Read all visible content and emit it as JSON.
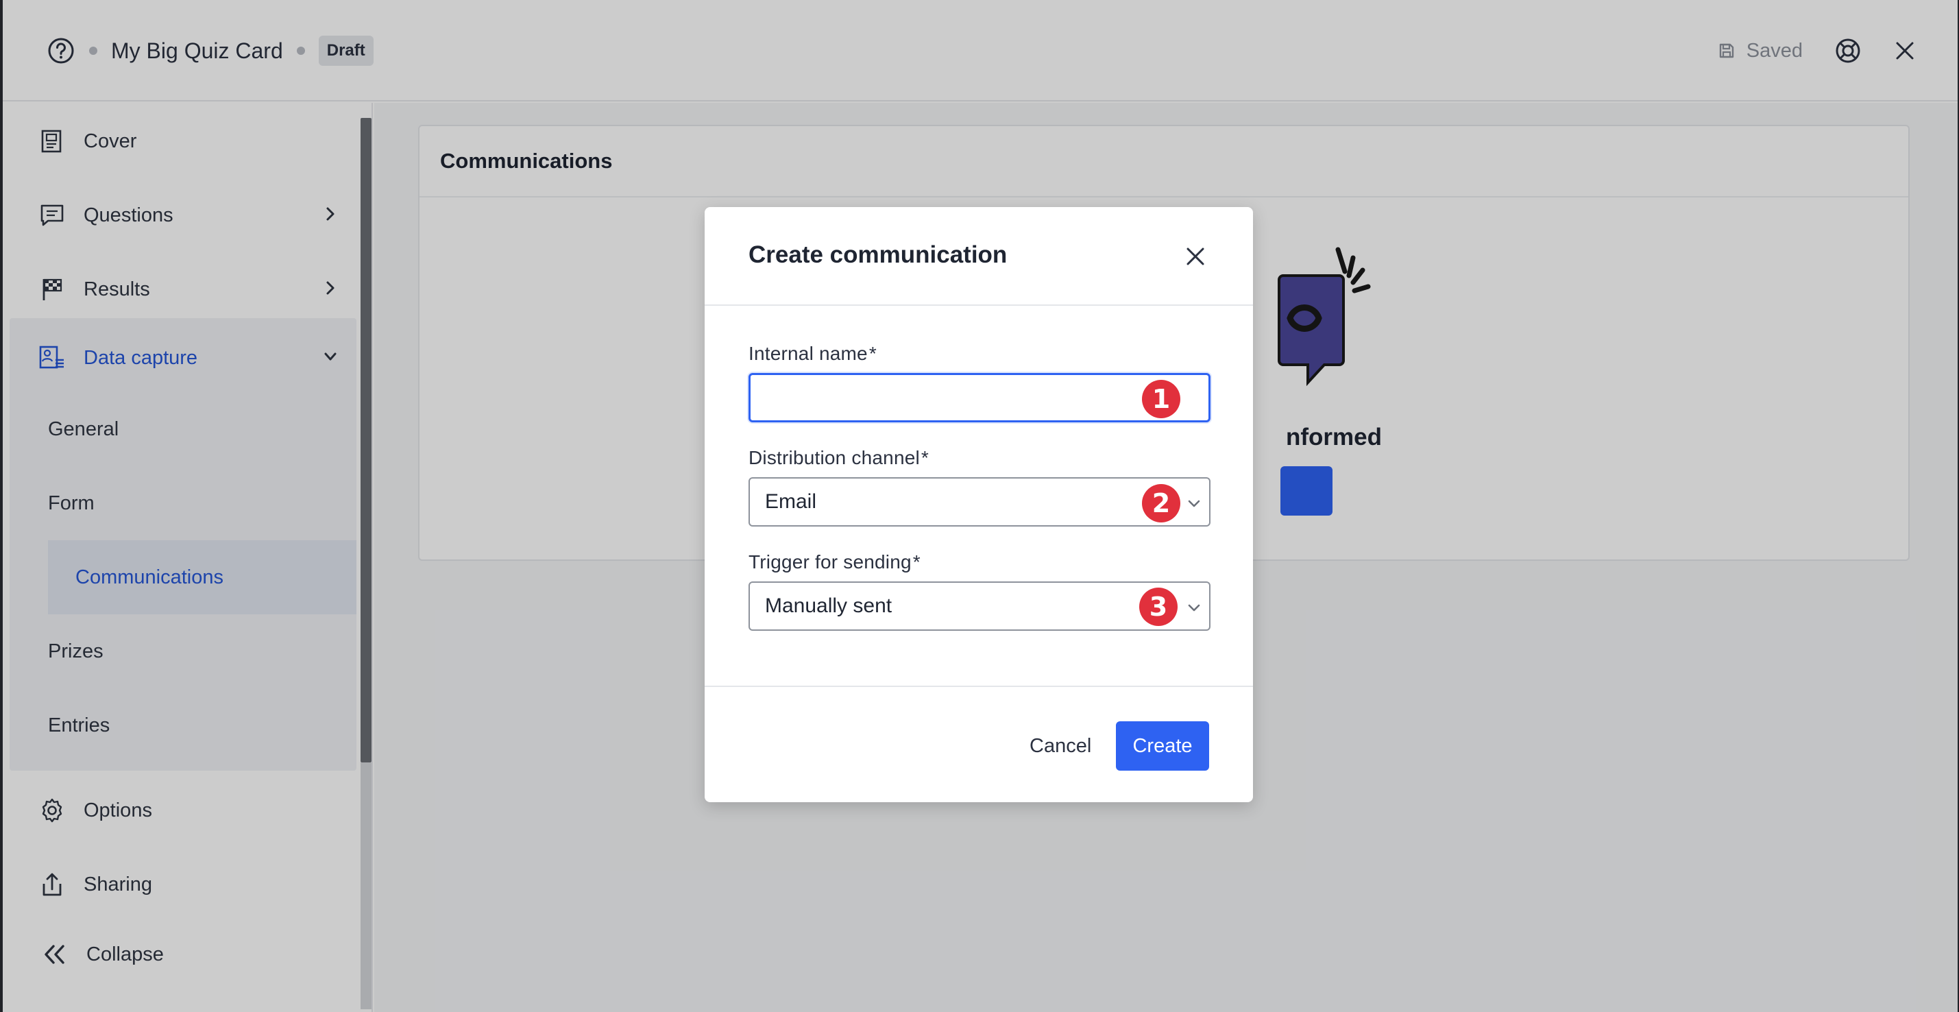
{
  "header": {
    "title": "My Big Quiz Card",
    "status_badge": "Draft",
    "saved_label": "Saved"
  },
  "sidebar": {
    "items": [
      {
        "label": "Cover",
        "icon": "cover-page-icon"
      },
      {
        "label": "Questions",
        "icon": "chat-bubble-icon"
      },
      {
        "label": "Results",
        "icon": "checkered-flag-icon"
      },
      {
        "label": "Data capture",
        "icon": "contact-form-icon"
      },
      {
        "label": "Options",
        "icon": "gear-icon"
      },
      {
        "label": "Sharing",
        "icon": "share-icon"
      },
      {
        "label": "Collapse",
        "icon": "double-chevron-left-icon"
      }
    ],
    "data_capture_subitems": [
      "General",
      "Form",
      "Communications",
      "Prizes",
      "Entries"
    ],
    "selected_subitem": "Communications"
  },
  "main": {
    "card_title": "Communications",
    "empty_state_text": "nformed"
  },
  "modal": {
    "title": "Create communication",
    "fields": [
      {
        "label": "Internal name",
        "required_mark": "*",
        "value": "",
        "badge": "1"
      },
      {
        "label": "Distribution channel",
        "required_mark": "*",
        "value": "Email",
        "badge": "2"
      },
      {
        "label": "Trigger for sending",
        "required_mark": "*",
        "value": "Manually sent",
        "badge": "3"
      }
    ],
    "cancel_label": "Cancel",
    "create_label": "Create"
  },
  "colors": {
    "accent": "#2e62f2",
    "badge_red": "#e1303c",
    "active_text": "#2556d6"
  }
}
